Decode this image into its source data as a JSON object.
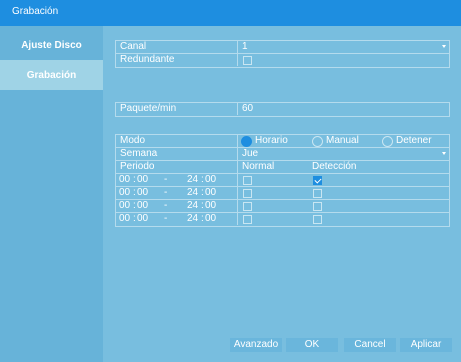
{
  "window": {
    "title": "Grabación"
  },
  "sidebar": {
    "items": [
      {
        "label": "Ajuste Disco",
        "active": false
      },
      {
        "label": "Grabación",
        "active": true
      }
    ]
  },
  "form": {
    "canal": {
      "label": "Canal",
      "value": "1"
    },
    "redundante": {
      "label": "Redundante",
      "checked": false
    },
    "paquete": {
      "label": "Paquete/min",
      "value": "60"
    },
    "modo": {
      "label": "Modo",
      "options": [
        "Horario",
        "Manual",
        "Detener"
      ],
      "selected": "Horario"
    },
    "semana": {
      "label": "Semana",
      "value": "Jue"
    },
    "periodo": {
      "label": "Periodo",
      "col_normal": "Normal",
      "col_deteccion": "Detección",
      "rows": [
        {
          "start_h": "00",
          "start_m": "00",
          "sep": "-",
          "end_h": "24",
          "end_m": "00",
          "normal": false,
          "deteccion": true
        },
        {
          "start_h": "00",
          "start_m": "00",
          "sep": "-",
          "end_h": "24",
          "end_m": "00",
          "normal": false,
          "deteccion": false
        },
        {
          "start_h": "00",
          "start_m": "00",
          "sep": "-",
          "end_h": "24",
          "end_m": "00",
          "normal": false,
          "deteccion": false
        },
        {
          "start_h": "00",
          "start_m": "00",
          "sep": "-",
          "end_h": "24",
          "end_m": "00",
          "normal": false,
          "deteccion": false
        }
      ]
    }
  },
  "buttons": {
    "avanzado": "Avanzado",
    "ok": "OK",
    "cancel": "Cancel",
    "aplicar": "Aplicar"
  },
  "colors": {
    "accent": "#1e8ee0",
    "background": "#5faed4",
    "panel": "#78bedf"
  }
}
